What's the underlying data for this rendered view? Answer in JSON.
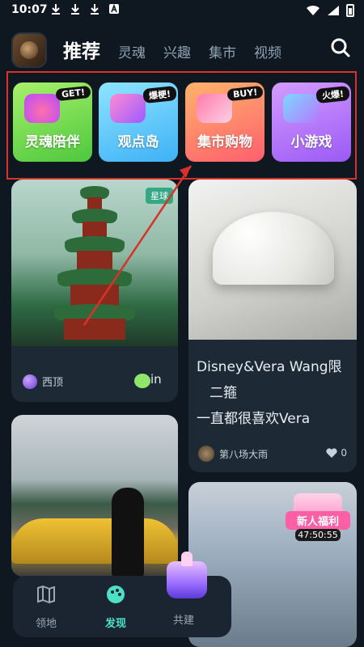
{
  "status_bar": {
    "time": "10:07"
  },
  "header": {
    "tabs": [
      {
        "label": "推荐",
        "active": true
      },
      {
        "label": "灵魂",
        "active": false
      },
      {
        "label": "兴趣",
        "active": false
      },
      {
        "label": "集市",
        "active": false
      },
      {
        "label": "视频",
        "active": false
      }
    ]
  },
  "features": [
    {
      "title": "灵魂陪伴",
      "badge": "GET!"
    },
    {
      "title": "观点岛",
      "badge": "爆梗!"
    },
    {
      "title": "集市购物",
      "badge": "BUY!"
    },
    {
      "title": "小游戏",
      "badge": "火爆!"
    }
  ],
  "feed": {
    "card1": {
      "tag": "星球",
      "author": "西顶",
      "aux_text": "in"
    },
    "card2": {
      "line1": "Disney&Vera Wang限",
      "line2": "二箍",
      "line3": "一直都很喜欢Vera",
      "author": "第八场大雨",
      "likes": "0"
    },
    "card4": {
      "promo_banner": "新人福利",
      "promo_timer": "47:50:55"
    }
  },
  "bottom_nav": [
    {
      "label": "领地",
      "active": false
    },
    {
      "label": "发现",
      "active": true
    },
    {
      "label": "共建",
      "active": false
    }
  ],
  "colors": {
    "highlight_box": "#d9312b",
    "accent": "#4de0c7"
  }
}
